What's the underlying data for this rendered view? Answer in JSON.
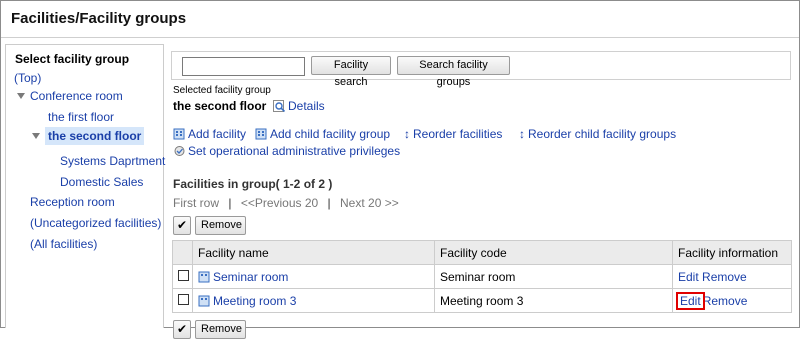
{
  "page": {
    "title": "Facilities/Facility groups"
  },
  "sidebar": {
    "heading": "Select facility group",
    "items": [
      {
        "label": "(Top)"
      },
      {
        "label": "Conference room"
      },
      {
        "label": "the first floor"
      },
      {
        "label": "the second floor"
      },
      {
        "label": "Systems Daprtment"
      },
      {
        "label": "Domestic Sales"
      },
      {
        "label": "Reception room"
      },
      {
        "label": "(Uncategorized facilities)"
      },
      {
        "label": "(All facilities)"
      }
    ]
  },
  "search": {
    "value": "",
    "facility_search_label": "Facility search",
    "group_search_label": "Search facility groups"
  },
  "selected_group": {
    "caption": "Selected facility group",
    "name": "the second floor",
    "details_label": "Details"
  },
  "actions": {
    "add_facility": "Add facility",
    "add_child_group": "Add child facility group",
    "reorder_facilities": "Reorder facilities",
    "reorder_child_groups": "Reorder child facility groups",
    "set_privileges": "Set operational administrative privileges"
  },
  "list": {
    "heading": "Facilities in group( 1-2 of 2 )",
    "first_row": "First row",
    "previous": "<<Previous 20",
    "next": "Next 20 >>",
    "sep": "|",
    "check_glyph": "✔",
    "remove_label": "Remove",
    "columns": {
      "name": "Facility name",
      "code": "Facility code",
      "info": "Facility information"
    },
    "rows": [
      {
        "name": "Seminar room",
        "code": "Seminar room",
        "edit": "Edit",
        "remove": "Remove"
      },
      {
        "name": "Meeting room 3",
        "code": "Meeting room 3",
        "edit": "Edit",
        "remove": "Remove"
      }
    ]
  },
  "colors": {
    "link": "#1a3fa8",
    "selected_bg": "#d5e6fa",
    "highlight": "#e00000",
    "header_bg": "#ebebeb"
  }
}
